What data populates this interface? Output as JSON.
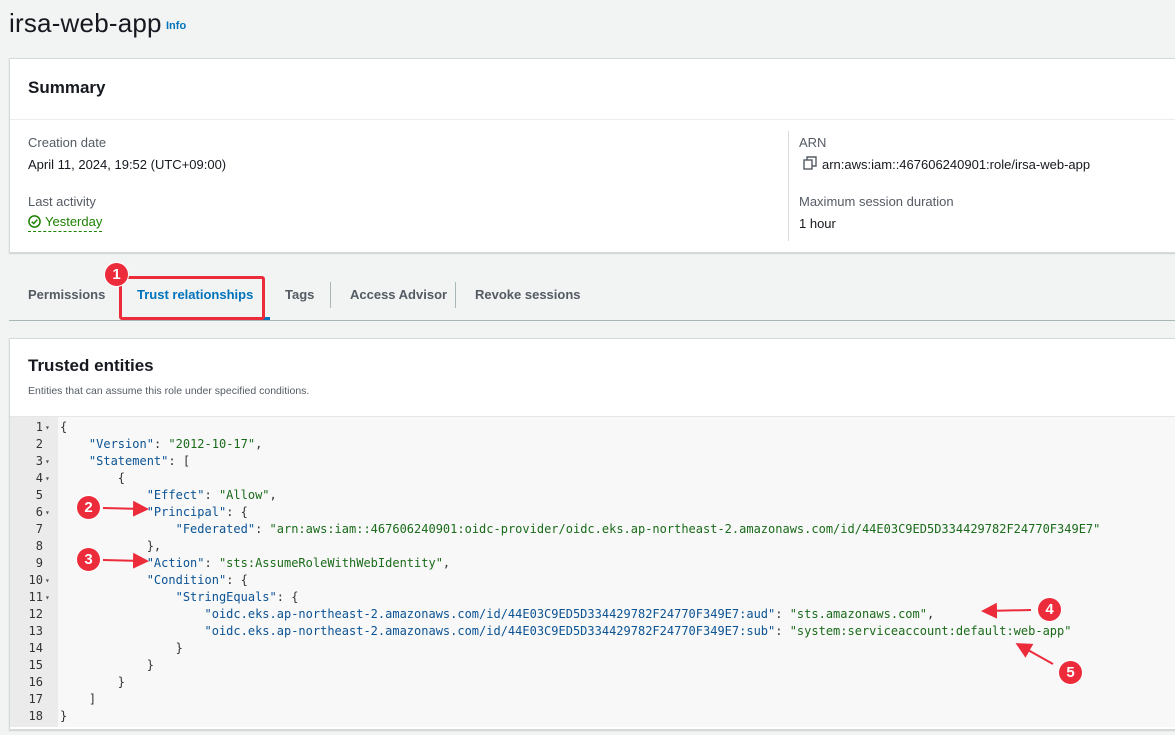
{
  "page": {
    "title": "irsa-web-app",
    "info_link": "Info"
  },
  "summary": {
    "heading": "Summary",
    "creation_date_label": "Creation date",
    "creation_date_value": "April 11, 2024, 19:52 (UTC+09:00)",
    "last_activity_label": "Last activity",
    "last_activity_value": "Yesterday",
    "arn_label": "ARN",
    "arn_value": "arn:aws:iam::467606240901:role/irsa-web-app",
    "max_session_label": "Maximum session duration",
    "max_session_value": "1 hour"
  },
  "tabs": [
    {
      "label": "Permissions"
    },
    {
      "label": "Trust relationships",
      "active": true
    },
    {
      "label": "Tags"
    },
    {
      "label": "Access Advisor"
    },
    {
      "label": "Revoke sessions"
    }
  ],
  "trusted_entities": {
    "heading": "Trusted entities",
    "description": "Entities that can assume this role under specified conditions.",
    "lines": [
      {
        "n": "1",
        "fold": true,
        "text": "{"
      },
      {
        "n": "2",
        "fold": false,
        "text": "    \"Version\": \"2012-10-17\","
      },
      {
        "n": "3",
        "fold": true,
        "text": "    \"Statement\": ["
      },
      {
        "n": "4",
        "fold": true,
        "text": "        {"
      },
      {
        "n": "5",
        "fold": false,
        "text": "            \"Effect\": \"Allow\","
      },
      {
        "n": "6",
        "fold": true,
        "text": "            \"Principal\": {"
      },
      {
        "n": "7",
        "fold": false,
        "text": "                \"Federated\": \"arn:aws:iam::467606240901:oidc-provider/oidc.eks.ap-northeast-2.amazonaws.com/id/44E03C9ED5D334429782F24770F349E7\""
      },
      {
        "n": "8",
        "fold": false,
        "text": "            },"
      },
      {
        "n": "9",
        "fold": false,
        "text": "            \"Action\": \"sts:AssumeRoleWithWebIdentity\","
      },
      {
        "n": "10",
        "fold": true,
        "text": "            \"Condition\": {"
      },
      {
        "n": "11",
        "fold": true,
        "text": "                \"StringEquals\": {"
      },
      {
        "n": "12",
        "fold": false,
        "text": "                    \"oidc.eks.ap-northeast-2.amazonaws.com/id/44E03C9ED5D334429782F24770F349E7:aud\": \"sts.amazonaws.com\","
      },
      {
        "n": "13",
        "fold": false,
        "text": "                    \"oidc.eks.ap-northeast-2.amazonaws.com/id/44E03C9ED5D334429782F24770F349E7:sub\": \"system:serviceaccount:default:web-app\""
      },
      {
        "n": "14",
        "fold": false,
        "text": "                }"
      },
      {
        "n": "15",
        "fold": false,
        "text": "            }"
      },
      {
        "n": "16",
        "fold": false,
        "text": "        }"
      },
      {
        "n": "17",
        "fold": false,
        "text": "    ]"
      },
      {
        "n": "18",
        "fold": false,
        "text": "}"
      }
    ]
  },
  "annotations": {
    "badge_1": "1",
    "badge_2": "2",
    "badge_3": "3",
    "badge_4": "4",
    "badge_5": "5",
    "accent_color": "#ec2b3b"
  },
  "colors": {
    "link": "#0073bb",
    "success": "#1d8102",
    "json_key": "#0b5394",
    "json_string": "#1a6b1a"
  },
  "icons": {
    "copy": "copy-icon",
    "status": "check-circle-icon"
  }
}
